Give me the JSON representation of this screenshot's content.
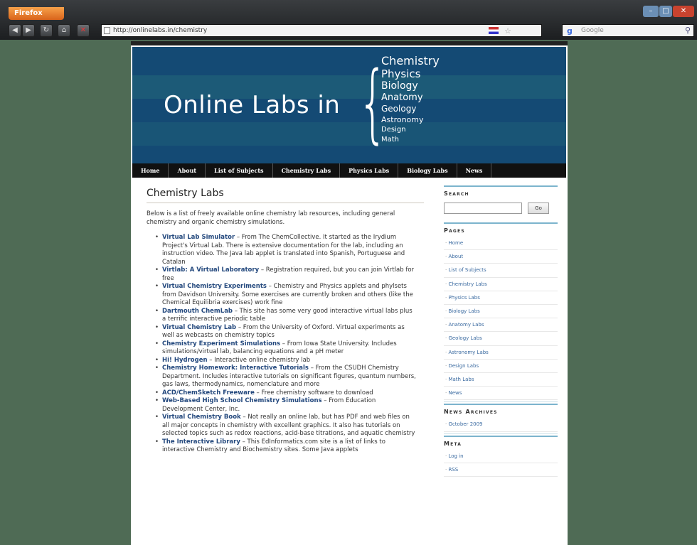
{
  "browser": {
    "menu_button": "Firefox",
    "url": "http://onlinelabs.in/chemistry",
    "search_placeholder": "Google"
  },
  "banner": {
    "title": "Online Labs in",
    "subjects": [
      "Chemistry",
      "Physics",
      "Biology",
      "Anatomy",
      "Geology",
      "Astronomy",
      "Design",
      "Math"
    ]
  },
  "nav": [
    {
      "label": "Home"
    },
    {
      "label": "About"
    },
    {
      "label": "List of Subjects"
    },
    {
      "label": "Chemistry Labs"
    },
    {
      "label": "Physics Labs"
    },
    {
      "label": "Biology Labs"
    },
    {
      "label": "News"
    }
  ],
  "main": {
    "heading": "Chemistry Labs",
    "intro": "Below is a list of freely available online chemistry lab resources, including general chemistry and organic chemistry simulations.",
    "labs": [
      {
        "title": "Virtual Lab Simulator",
        "desc": " – From The ChemCollective. It started as the Irydium Project's Virtual Lab. There is extensive documentation for the lab, including an instruction video. The Java lab applet is translated into Spanish, Portuguese and Catalan"
      },
      {
        "title": "Virtlab: A Virtual Laboratory",
        "desc": " – Registration required, but you can join Virtlab for free"
      },
      {
        "title": "Virtual Chemistry Experiments",
        "desc": " – Chemistry and Physics applets and phylsets from Davidson University. Some exercises are currently broken and others (like the Chemical Equilibria exercises) work fine"
      },
      {
        "title": "Dartmouth ChemLab",
        "desc": " – This site has some very good interactive virtual labs plus a terrific interactive periodic table"
      },
      {
        "title": "Virtual Chemistry Lab",
        "desc": " – From the University of Oxford. Virtual experiments as well as webcasts on chemistry topics"
      },
      {
        "title": "Chemistry Experiment Simulations",
        "desc": " – From Iowa State University. Includes simulations/virtual lab, balancing equations and a pH meter"
      },
      {
        "title": "Hi! Hydrogen",
        "desc": " – Interactive online chemistry lab"
      },
      {
        "title": "Chemistry Homework: Interactive Tutorials",
        "desc": " – From the CSUDH Chemistry Department. Includes interactive tutorials on significant figures, quantum numbers, gas laws, thermodynamics, nomenclature and more"
      },
      {
        "title": "ACD/ChemSketch Freeware",
        "desc": " – Free chemistry software to download"
      },
      {
        "title": "Web-Based High School Chemistry Simulations",
        "desc": " – From Education Development Center, Inc."
      },
      {
        "title": "Virtual Chemistry Book",
        "desc": " – Not really an online lab, but has PDF and web files on all major concepts in chemistry with excellent graphics. It also has tutorials on selected topics such as redox reactions, acid-base titrations, and aquatic chemistry"
      },
      {
        "title": "The Interactive Library",
        "desc": " – This EdInformatics.com site is a list of links to interactive Chemistry and Biochemistry sites. Some Java applets"
      }
    ]
  },
  "sidebar": {
    "search_heading": "Search",
    "search_button": "Go",
    "pages_heading": "Pages",
    "pages": [
      "Home",
      "About",
      "List of Subjects",
      "Chemistry Labs",
      "Physics Labs",
      "Biology Labs",
      "Anatomy Labs",
      "Geology Labs",
      "Astronomy Labs",
      "Design Labs",
      "Math Labs",
      "News"
    ],
    "archives_heading": "News Archives",
    "archives": [
      "October 2009"
    ],
    "meta_heading": "Meta",
    "meta": [
      "Log in",
      "RSS"
    ]
  }
}
